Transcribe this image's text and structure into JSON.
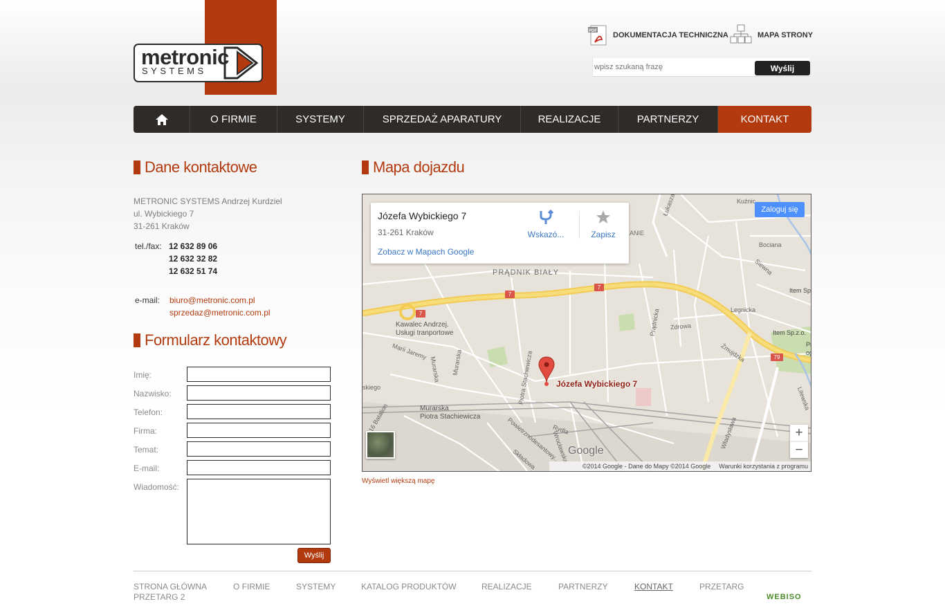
{
  "header": {
    "logo_name": "metronic",
    "logo_sub": "SYSTEMS",
    "doc_link": "DOKUMENTACJA TECHNICZNA",
    "sitemap_link": "MAPA STRONY",
    "search_placeholder": "wpisz szukaną frazę",
    "search_button": "Wyślij"
  },
  "nav": {
    "items": [
      {
        "label": "O FIRMIE"
      },
      {
        "label": "SYSTEMY"
      },
      {
        "label": "SPRZEDAŻ APARATURY"
      },
      {
        "label": "REALIZACJE"
      },
      {
        "label": "PARTNERZY"
      },
      {
        "label": "KONTAKT"
      }
    ]
  },
  "contact": {
    "title": "Dane kontaktowe",
    "address": [
      "METRONIC SYSTEMS Andrzej Kurdziel",
      "ul. Wybickiego 7",
      "31-261 Kraków"
    ],
    "tel_label": "tel./fax:",
    "phones": [
      "12 632 89 06",
      "12 632 32 82",
      "12 632 51 74"
    ],
    "email_label": "e-mail:",
    "emails": [
      "biuro@metronic.com.pl",
      "sprzedaz@metronic.com.pl"
    ]
  },
  "form": {
    "title": "Formularz kontaktowy",
    "labels": [
      "Imię:",
      "Nazwisko:",
      "Telefon:",
      "Firma:",
      "Temat:",
      "E-mail:",
      "Wiadomość:"
    ],
    "submit": "Wyślij"
  },
  "map": {
    "title": "Mapa dojazdu",
    "place_name": "Józefa Wybickiego 7",
    "place_city": "31-261 Kraków",
    "directions": "Wskazó...",
    "save": "Zapisz",
    "view_link": "Zobacz w Mapach Google",
    "login": "Zaloguj się",
    "marker_label": "Józefa Wybickiego 7",
    "districts": [
      "PRĄDNIK BIAŁY",
      "ANIE"
    ],
    "streets": [
      "Łukasza",
      "Kuźnic",
      "Bociana",
      "Siewna",
      "Item Sp",
      "Legnicka",
      "Item Sp.z.o.",
      "Proj",
      "ogro",
      "Zdrowa",
      "Żmujdzka",
      "Prądnicka",
      "Kawalec Andrzej.",
      "Usługi tranportowe",
      "Marii Jaremy",
      "Murarska",
      "Piotra Stachiewicza",
      "16 Batalion",
      "Powietrznodesantowy...",
      "Rydla",
      "Wrocławska",
      "Składowa",
      "Władysława",
      "Litewska",
      "29 Listopada",
      "Gdańska",
      "skiego"
    ],
    "road_numbers": [
      "7",
      "7",
      "7",
      "79"
    ],
    "google": "Google",
    "copyright": "©2014 Google - Dane do Mapy ©2014 Google",
    "terms": "Warunki korzystania z programu",
    "zoom_in": "+",
    "zoom_out": "−",
    "bigger_map": "Wyświetl większą mapę"
  },
  "footer": {
    "links": [
      "STRONA GŁÓWNA",
      "O FIRMIE",
      "SYSTEMY",
      "KATALOG PRODUKTÓW",
      "REALIZACJE",
      "PARTNERZY",
      "KONTAKT",
      "PRZETARG",
      "PRZETARG 2"
    ],
    "badge": "WEBISO"
  },
  "colors": {
    "accent": "#b23a0e",
    "nav_bg": "#2e2b29"
  }
}
